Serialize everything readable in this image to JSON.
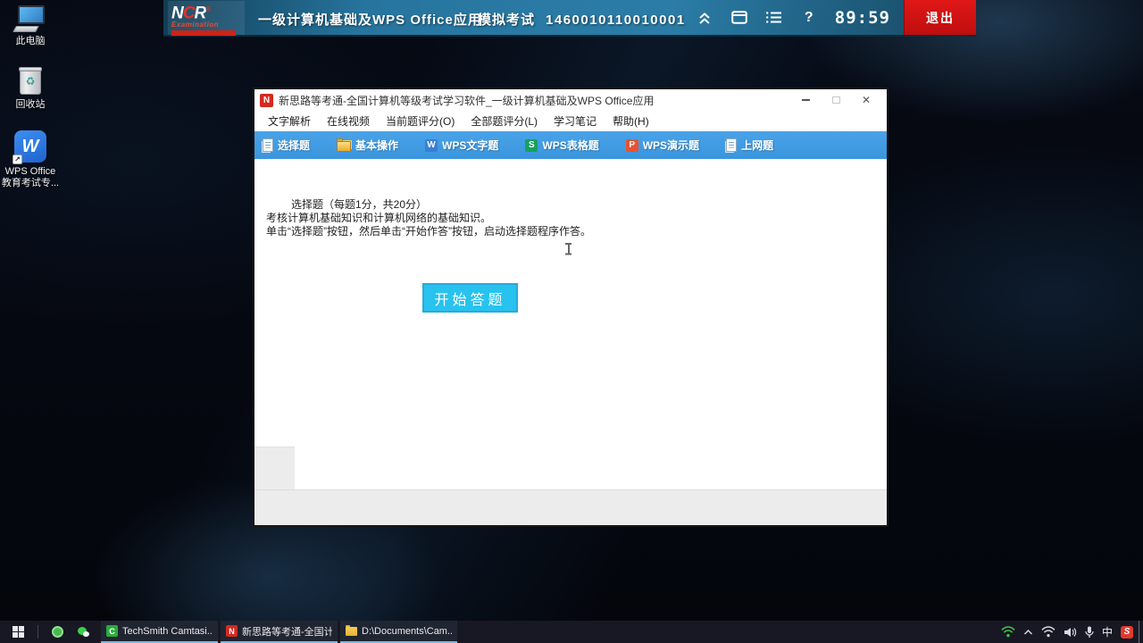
{
  "colors": {
    "toolbar_blue": "#3f9ce2",
    "start_button_cyan": "#28c2ef",
    "exit_red": "#d41414",
    "taskbar_underline": "#76b9e8"
  },
  "desktop": {
    "icons": [
      {
        "label": "此电脑"
      },
      {
        "label": "回收站"
      },
      {
        "label_line1": "WPS Office",
        "label_line2": "教育考试专...",
        "badge": "W"
      }
    ]
  },
  "topbar": {
    "logo": {
      "l1": "N",
      "l2": "C",
      "l3": "R",
      "reg": "®",
      "sub": "Examination"
    },
    "course_title": "一级计算机基础及WPS Office应用",
    "exam_type": "模拟考试",
    "exam_id": "1460010110010001",
    "help_glyph": "?",
    "timer": "89:59",
    "exit_label": "退出"
  },
  "window": {
    "icon_letter": "N",
    "title": "新思路等考通-全国计算机等级考试学习软件_一级计算机基础及WPS Office应用",
    "close_glyph": "✕",
    "menu": [
      "文字解析",
      "在线视频",
      "当前题评分(O)",
      "全部题评分(L)",
      "学习笔记",
      "帮助(H)"
    ],
    "tabs": [
      {
        "label": "选择题"
      },
      {
        "label": "基本操作"
      },
      {
        "label": "WPS文字题",
        "badge": "W"
      },
      {
        "label": "WPS表格题",
        "badge": "S"
      },
      {
        "label": "WPS演示题",
        "badge": "P"
      },
      {
        "label": "上网题"
      }
    ],
    "content": {
      "line1": "选择题（每题1分，共20分）",
      "line2": "考核计算机基础知识和计算机网络的基础知识。",
      "line3": "单击“选择题”按钮，然后单击“开始作答”按钮，启动选择题程序作答。",
      "start_button": "开始答题"
    }
  },
  "taskbar": {
    "buttons": [
      {
        "label": "TechSmith Camtasi...",
        "badge": "C"
      },
      {
        "label": "新思路等考通-全国计...",
        "badge": "N"
      },
      {
        "label": "D:\\Documents\\Cam...",
        "badge": ""
      }
    ],
    "tray": {
      "ime": "中",
      "sogou": "S"
    }
  }
}
